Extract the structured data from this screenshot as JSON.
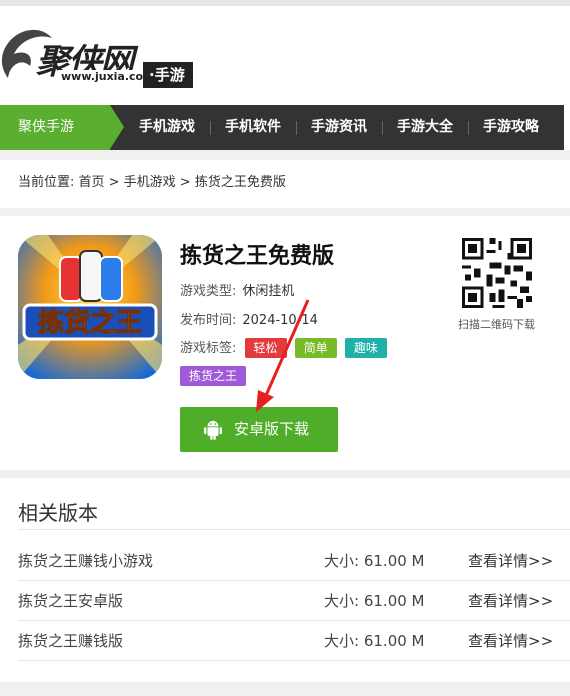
{
  "header": {
    "logo_text": "聚侠网",
    "logo_url": "www.juxia.com",
    "logo_sub": "·手游"
  },
  "nav": {
    "home": "聚侠手游",
    "items": [
      "手机游戏",
      "手机软件",
      "手游资讯",
      "手游大全",
      "手游攻略"
    ]
  },
  "breadcrumb": "当前位置:  首页 > 手机游戏 > 拣货之王免费版",
  "game": {
    "title": "拣货之王免费版",
    "type_label": "游戏类型:",
    "type_value": "休闲挂机",
    "date_label": "发布时间:",
    "date_value": "2024-10-14",
    "tags_label": "游戏标签:",
    "tags": [
      "轻松",
      "简单",
      "趣味",
      "拣货之王"
    ],
    "download_label": "安卓版下载",
    "qr_label": "扫描二维码下载",
    "icon_text": "拣货之王"
  },
  "related": {
    "title": "相关版本",
    "size_prefix": "大小:",
    "link_label": "查看详情>>",
    "items": [
      {
        "name": "拣货之王赚钱小游戏",
        "size": "61.00 M"
      },
      {
        "name": "拣货之王安卓版",
        "size": "61.00 M"
      },
      {
        "name": "拣货之王赚钱版",
        "size": "61.00 M"
      }
    ]
  },
  "colors": {
    "accent_green": "#5aae30",
    "nav_bg": "#333333",
    "tag_red": "#e33b3b",
    "tag_green": "#77bb2a",
    "tag_teal": "#1fb0a8",
    "tag_purple": "#a05ad8"
  }
}
